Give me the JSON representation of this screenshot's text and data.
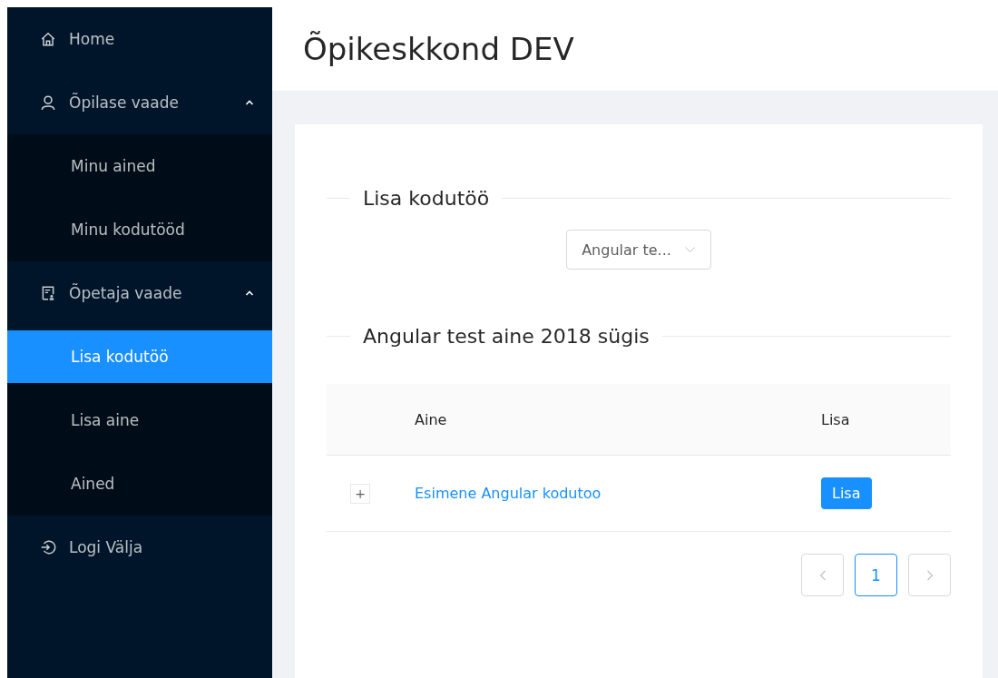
{
  "sidebar": {
    "items": [
      {
        "kind": "item",
        "label": "Home",
        "selected": false
      },
      {
        "kind": "group",
        "label": "Õpilase vaade",
        "expanded": true,
        "children": [
          {
            "label": "Minu ained",
            "selected": false
          },
          {
            "label": "Minu kodutööd",
            "selected": false
          }
        ]
      },
      {
        "kind": "group",
        "label": "Õpetaja vaade",
        "expanded": true,
        "children": [
          {
            "label": "Lisa kodutöö",
            "selected": true
          },
          {
            "label": "Lisa aine",
            "selected": false
          },
          {
            "label": "Ained",
            "selected": false
          }
        ]
      },
      {
        "kind": "item",
        "label": "Logi Välja",
        "selected": false
      }
    ]
  },
  "header": {
    "title": "Õpikeskkond DEV"
  },
  "sections": [
    {
      "kind": "select",
      "title": "Lisa kodutöö",
      "select": {
        "value": "Angular te..."
      }
    },
    {
      "kind": "table",
      "title": "Angular test aine 2018 sügis",
      "table": {
        "columns": [
          "Aine",
          "Lisa"
        ],
        "rows": [
          {
            "expand": "+",
            "name": "Esimene Angular kodutoo",
            "button": "Lisa"
          }
        ]
      },
      "pagination": {
        "prev": {
          "disabled": true
        },
        "pages": [
          {
            "label": "1",
            "selected": true
          }
        ],
        "next": {
          "disabled": true
        }
      }
    }
  ]
}
